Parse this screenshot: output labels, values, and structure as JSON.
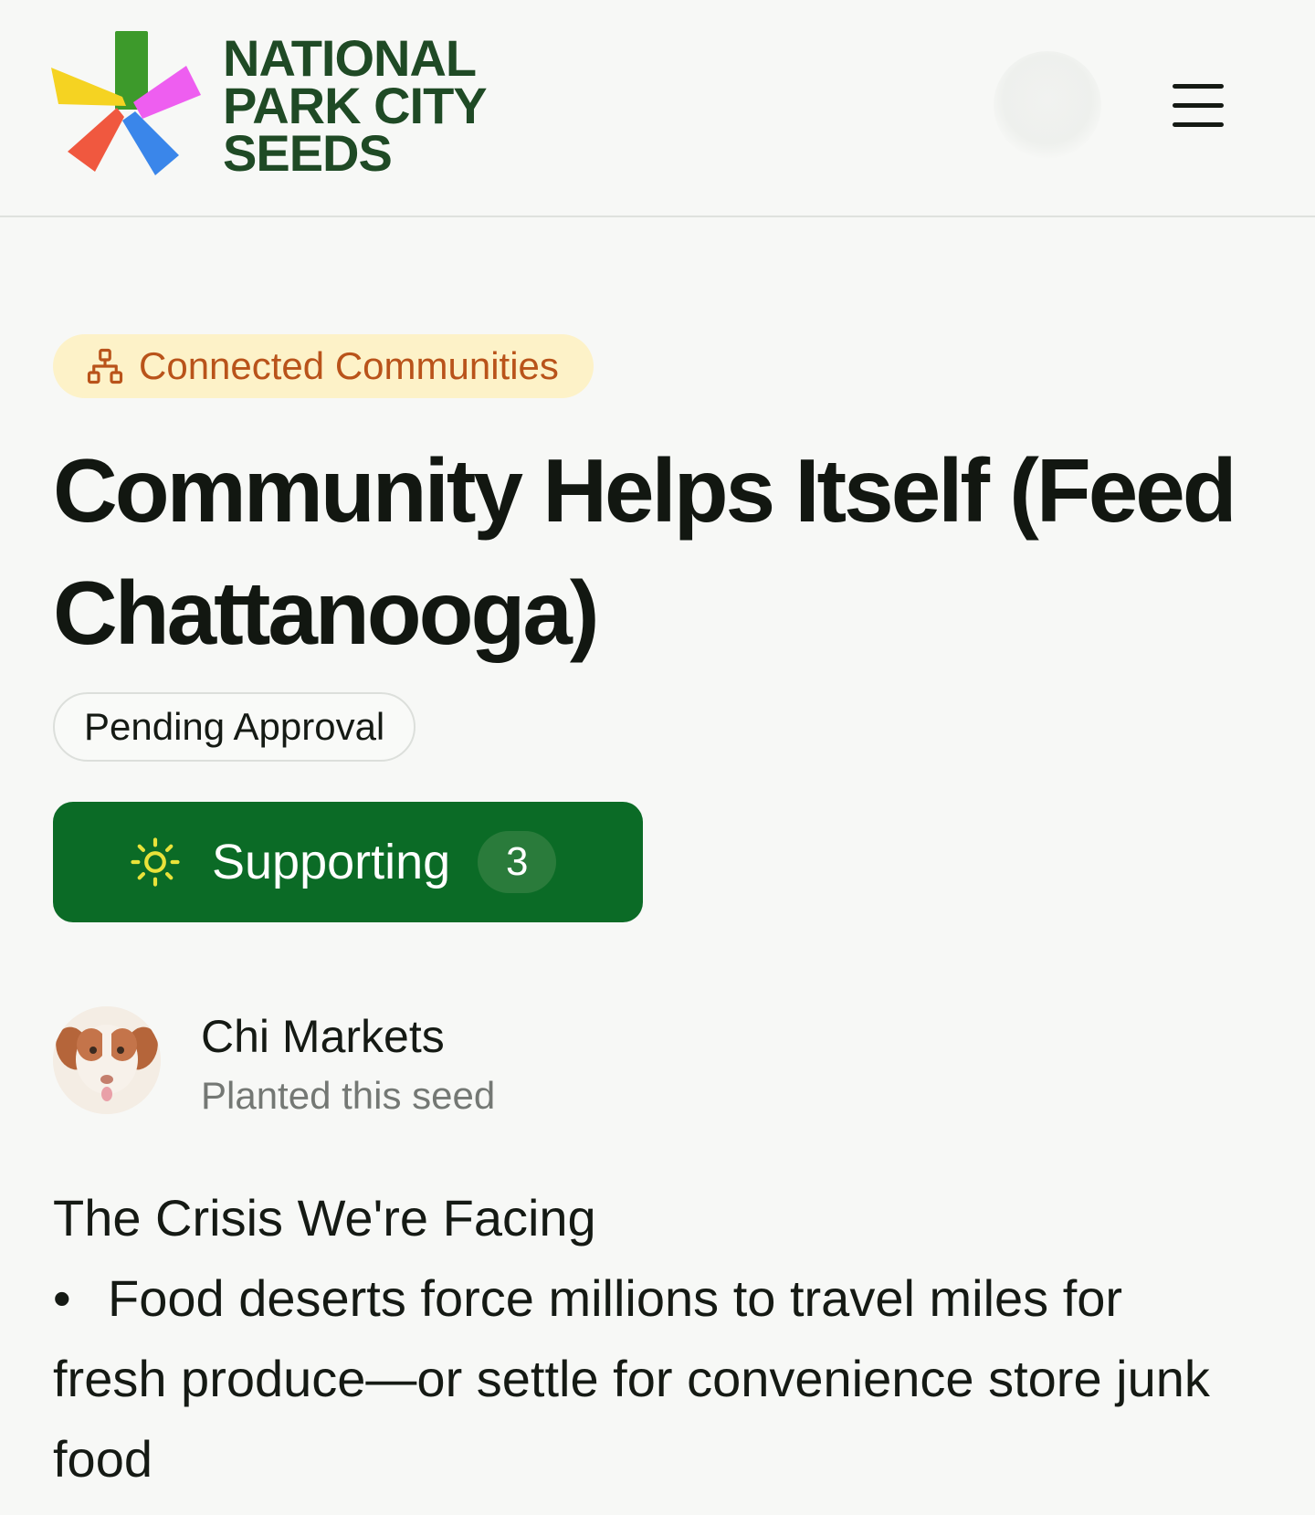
{
  "header": {
    "logo_lines": [
      "NATIONAL",
      "PARK CITY",
      "SEEDS"
    ],
    "logo_colors": {
      "green": "#3d9a2b",
      "magenta": "#ee5ef0",
      "yellow": "#f5d322",
      "red": "#f0583f",
      "blue": "#3a86ea"
    },
    "menu_icon": "hamburger-menu-icon"
  },
  "category": {
    "label": "Connected Communities",
    "icon": "network-icon"
  },
  "title": "Community Helps Itself (Feed Chattanooga)",
  "status": "Pending Approval",
  "support": {
    "label": "Supporting",
    "count": "3",
    "icon": "sun-icon",
    "button_color": "#0b6b26"
  },
  "author": {
    "name": "Chi Markets",
    "subtitle": "Planted this seed"
  },
  "content": {
    "heading": "The Crisis We're Facing",
    "bullet_symbol": "•",
    "bullet": "Food deserts force millions to travel miles for fresh produce—or settle for convenience store junk food"
  }
}
